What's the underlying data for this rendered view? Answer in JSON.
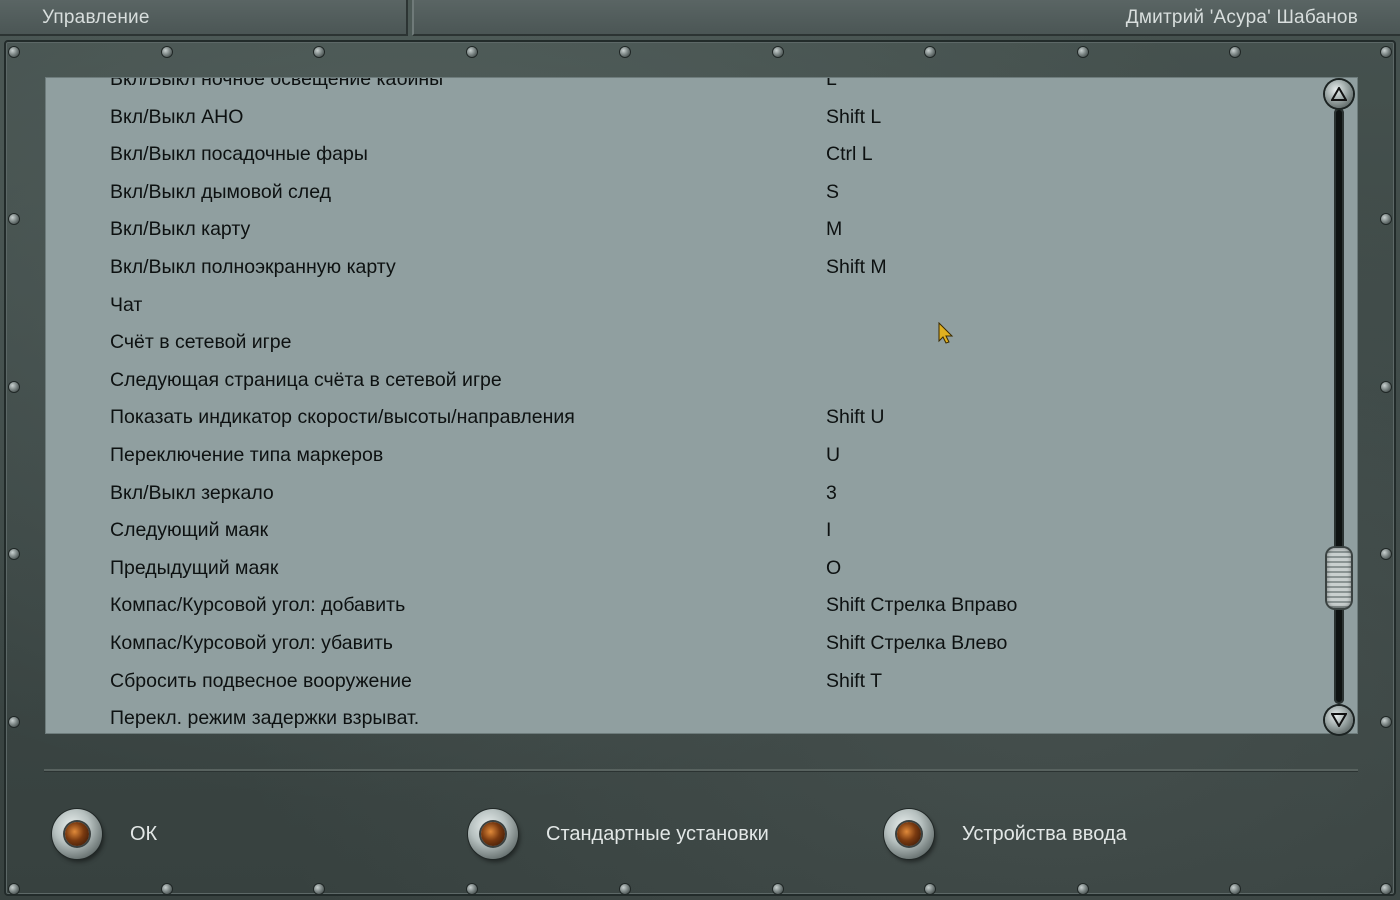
{
  "header": {
    "left_title": "Управление",
    "right_title": "Дмитрий 'Асура' Шабанов"
  },
  "controls_list": {
    "rows": [
      {
        "action": "Вкл/Выкл ночное освещение кабины",
        "key": "L"
      },
      {
        "action": "Вкл/Выкл АНО",
        "key": "Shift L"
      },
      {
        "action": "Вкл/Выкл посадочные фары",
        "key": "Ctrl L"
      },
      {
        "action": "Вкл/Выкл дымовой след",
        "key": "S"
      },
      {
        "action": "Вкл/Выкл карту",
        "key": "M"
      },
      {
        "action": "Вкл/Выкл полноэкранную карту",
        "key": "Shift M"
      },
      {
        "action": "Чат",
        "key": ""
      },
      {
        "action": "Счёт в сетевой игре",
        "key": ""
      },
      {
        "action": "Следующая страница счёта в сетевой игре",
        "key": ""
      },
      {
        "action": "Показать индикатор скорости/высоты/направления",
        "key": "Shift U"
      },
      {
        "action": "Переключение типа маркеров",
        "key": "U"
      },
      {
        "action": "Вкл/Выкл зеркало",
        "key": "3"
      },
      {
        "action": "Следующий маяк",
        "key": "I"
      },
      {
        "action": "Предыдущий маяк",
        "key": "O"
      },
      {
        "action": "Компас/Курсовой угол: добавить",
        "key": "Shift Стрелка Вправо"
      },
      {
        "action": "Компас/Курсовой угол: убавить",
        "key": "Shift Стрелка Влево"
      },
      {
        "action": "Сбросить подвесное вооружение",
        "key": "Shift T"
      },
      {
        "action": "Перекл. режим задержки взрыват.",
        "key": ""
      }
    ]
  },
  "scrollbar": {
    "up_icon": "triangle-up-icon",
    "down_icon": "triangle-down-icon"
  },
  "buttons": {
    "ok_label": "ОК",
    "defaults_label": "Стандартные установки",
    "devices_label": "Устройства ввода"
  }
}
